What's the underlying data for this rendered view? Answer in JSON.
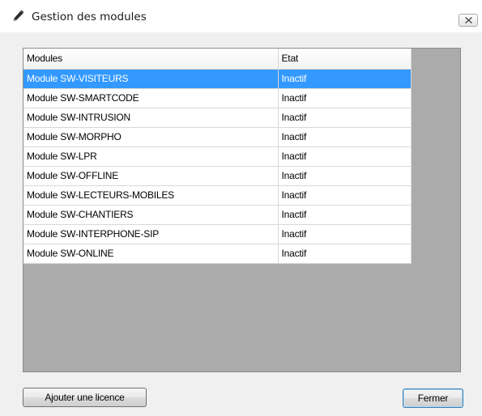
{
  "window": {
    "title": "Gestion des modules",
    "title_icon": "pencil-icon",
    "close_icon": "close-icon"
  },
  "grid": {
    "columns": [
      "Modules",
      "Etat"
    ],
    "rows": [
      {
        "module": "Module SW-VISITEURS",
        "etat": "Inactif",
        "selected": true
      },
      {
        "module": "Module SW-SMARTCODE",
        "etat": "Inactif",
        "selected": false
      },
      {
        "module": "Module SW-INTRUSION",
        "etat": "Inactif",
        "selected": false
      },
      {
        "module": "Module SW-MORPHO",
        "etat": "Inactif",
        "selected": false
      },
      {
        "module": "Module SW-LPR",
        "etat": "Inactif",
        "selected": false
      },
      {
        "module": "Module SW-OFFLINE",
        "etat": "Inactif",
        "selected": false
      },
      {
        "module": "Module SW-LECTEURS-MOBILES",
        "etat": "Inactif",
        "selected": false
      },
      {
        "module": "Module SW-CHANTIERS",
        "etat": "Inactif",
        "selected": false
      },
      {
        "module": "Module SW-INTERPHONE-SIP",
        "etat": "Inactif",
        "selected": false
      },
      {
        "module": "Module SW-ONLINE",
        "etat": "Inactif",
        "selected": false
      }
    ]
  },
  "buttons": {
    "add_license": "Ajouter une licence",
    "close": "Fermer"
  },
  "colors": {
    "selection": "#3399ff",
    "grid_background": "#ababab",
    "window_background": "#f0f0f0"
  }
}
